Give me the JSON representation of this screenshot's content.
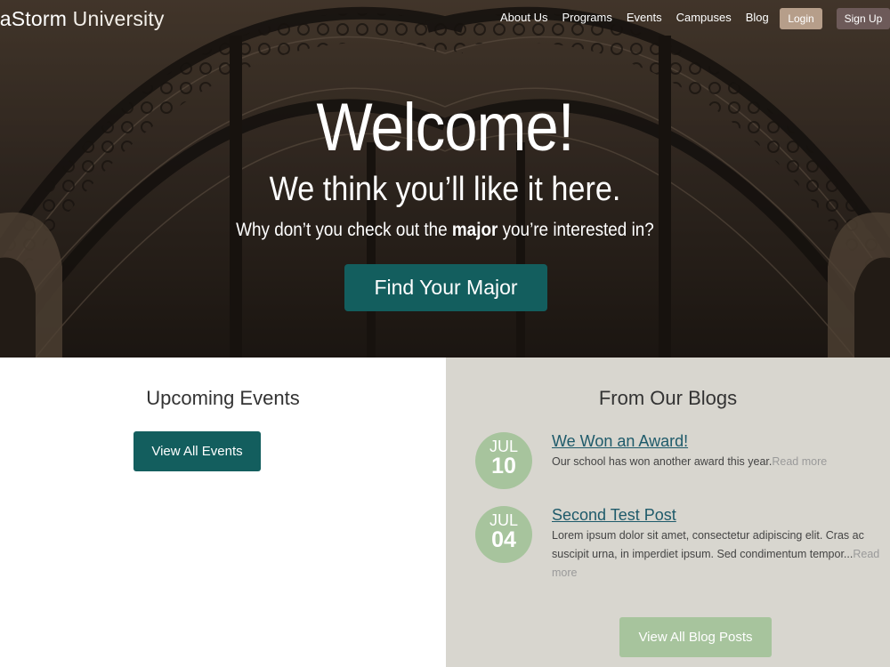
{
  "brand": {
    "name_bold": "rraStorm",
    "name_light": "University"
  },
  "nav": {
    "items": [
      {
        "label": "About Us"
      },
      {
        "label": "Programs"
      },
      {
        "label": "Events"
      },
      {
        "label": "Campuses"
      },
      {
        "label": "Blog"
      }
    ],
    "login_label": "Login",
    "signup_label": "Sign Up"
  },
  "hero": {
    "title": "Welcome!",
    "subtitle": "We think you’ll like it here.",
    "line_before": "Why don’t you check out the ",
    "line_bold": "major",
    "line_after": " you’re interested in?",
    "cta_label": "Find Your Major"
  },
  "events": {
    "heading": "Upcoming Events",
    "button_label": "View All Events"
  },
  "blogs": {
    "heading": "From Our Blogs",
    "posts": [
      {
        "month": "JUL",
        "day": "10",
        "title": "We Won an Award!",
        "excerpt": "Our school has won another award this year.",
        "readmore": "Read more"
      },
      {
        "month": "JUL",
        "day": "04",
        "title": "Second Test Post",
        "excerpt": "Lorem ipsum dolor sit amet, consectetur adipiscing elit. Cras ac suscipit urna, in imperdiet ipsum. Sed condimentum tempor...",
        "readmore": "Read more"
      }
    ],
    "button_label": "View All Blog Posts"
  },
  "colors": {
    "primary_teal": "#135e5e",
    "sage": "#a7c49d",
    "login_tan": "#b69e8a",
    "signup_mauve": "#6d5a59",
    "blog_bg": "#d8d6cf"
  }
}
